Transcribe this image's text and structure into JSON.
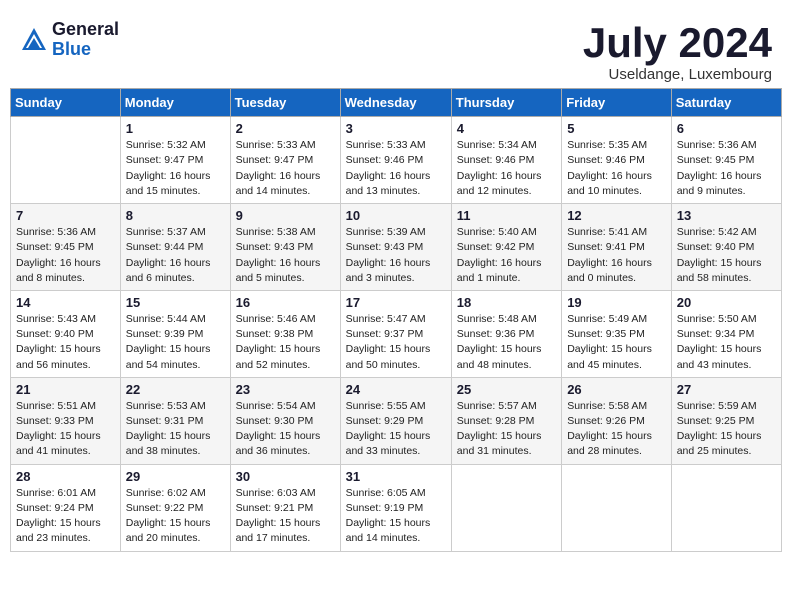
{
  "header": {
    "logo_general": "General",
    "logo_blue": "Blue",
    "month_title": "July 2024",
    "location": "Useldange, Luxembourg"
  },
  "days_of_week": [
    "Sunday",
    "Monday",
    "Tuesday",
    "Wednesday",
    "Thursday",
    "Friday",
    "Saturday"
  ],
  "weeks": [
    [
      {
        "day": "",
        "info": ""
      },
      {
        "day": "1",
        "info": "Sunrise: 5:32 AM\nSunset: 9:47 PM\nDaylight: 16 hours\nand 15 minutes."
      },
      {
        "day": "2",
        "info": "Sunrise: 5:33 AM\nSunset: 9:47 PM\nDaylight: 16 hours\nand 14 minutes."
      },
      {
        "day": "3",
        "info": "Sunrise: 5:33 AM\nSunset: 9:46 PM\nDaylight: 16 hours\nand 13 minutes."
      },
      {
        "day": "4",
        "info": "Sunrise: 5:34 AM\nSunset: 9:46 PM\nDaylight: 16 hours\nand 12 minutes."
      },
      {
        "day": "5",
        "info": "Sunrise: 5:35 AM\nSunset: 9:46 PM\nDaylight: 16 hours\nand 10 minutes."
      },
      {
        "day": "6",
        "info": "Sunrise: 5:36 AM\nSunset: 9:45 PM\nDaylight: 16 hours\nand 9 minutes."
      }
    ],
    [
      {
        "day": "7",
        "info": "Sunrise: 5:36 AM\nSunset: 9:45 PM\nDaylight: 16 hours\nand 8 minutes."
      },
      {
        "day": "8",
        "info": "Sunrise: 5:37 AM\nSunset: 9:44 PM\nDaylight: 16 hours\nand 6 minutes."
      },
      {
        "day": "9",
        "info": "Sunrise: 5:38 AM\nSunset: 9:43 PM\nDaylight: 16 hours\nand 5 minutes."
      },
      {
        "day": "10",
        "info": "Sunrise: 5:39 AM\nSunset: 9:43 PM\nDaylight: 16 hours\nand 3 minutes."
      },
      {
        "day": "11",
        "info": "Sunrise: 5:40 AM\nSunset: 9:42 PM\nDaylight: 16 hours\nand 1 minute."
      },
      {
        "day": "12",
        "info": "Sunrise: 5:41 AM\nSunset: 9:41 PM\nDaylight: 16 hours\nand 0 minutes."
      },
      {
        "day": "13",
        "info": "Sunrise: 5:42 AM\nSunset: 9:40 PM\nDaylight: 15 hours\nand 58 minutes."
      }
    ],
    [
      {
        "day": "14",
        "info": "Sunrise: 5:43 AM\nSunset: 9:40 PM\nDaylight: 15 hours\nand 56 minutes."
      },
      {
        "day": "15",
        "info": "Sunrise: 5:44 AM\nSunset: 9:39 PM\nDaylight: 15 hours\nand 54 minutes."
      },
      {
        "day": "16",
        "info": "Sunrise: 5:46 AM\nSunset: 9:38 PM\nDaylight: 15 hours\nand 52 minutes."
      },
      {
        "day": "17",
        "info": "Sunrise: 5:47 AM\nSunset: 9:37 PM\nDaylight: 15 hours\nand 50 minutes."
      },
      {
        "day": "18",
        "info": "Sunrise: 5:48 AM\nSunset: 9:36 PM\nDaylight: 15 hours\nand 48 minutes."
      },
      {
        "day": "19",
        "info": "Sunrise: 5:49 AM\nSunset: 9:35 PM\nDaylight: 15 hours\nand 45 minutes."
      },
      {
        "day": "20",
        "info": "Sunrise: 5:50 AM\nSunset: 9:34 PM\nDaylight: 15 hours\nand 43 minutes."
      }
    ],
    [
      {
        "day": "21",
        "info": "Sunrise: 5:51 AM\nSunset: 9:33 PM\nDaylight: 15 hours\nand 41 minutes."
      },
      {
        "day": "22",
        "info": "Sunrise: 5:53 AM\nSunset: 9:31 PM\nDaylight: 15 hours\nand 38 minutes."
      },
      {
        "day": "23",
        "info": "Sunrise: 5:54 AM\nSunset: 9:30 PM\nDaylight: 15 hours\nand 36 minutes."
      },
      {
        "day": "24",
        "info": "Sunrise: 5:55 AM\nSunset: 9:29 PM\nDaylight: 15 hours\nand 33 minutes."
      },
      {
        "day": "25",
        "info": "Sunrise: 5:57 AM\nSunset: 9:28 PM\nDaylight: 15 hours\nand 31 minutes."
      },
      {
        "day": "26",
        "info": "Sunrise: 5:58 AM\nSunset: 9:26 PM\nDaylight: 15 hours\nand 28 minutes."
      },
      {
        "day": "27",
        "info": "Sunrise: 5:59 AM\nSunset: 9:25 PM\nDaylight: 15 hours\nand 25 minutes."
      }
    ],
    [
      {
        "day": "28",
        "info": "Sunrise: 6:01 AM\nSunset: 9:24 PM\nDaylight: 15 hours\nand 23 minutes."
      },
      {
        "day": "29",
        "info": "Sunrise: 6:02 AM\nSunset: 9:22 PM\nDaylight: 15 hours\nand 20 minutes."
      },
      {
        "day": "30",
        "info": "Sunrise: 6:03 AM\nSunset: 9:21 PM\nDaylight: 15 hours\nand 17 minutes."
      },
      {
        "day": "31",
        "info": "Sunrise: 6:05 AM\nSunset: 9:19 PM\nDaylight: 15 hours\nand 14 minutes."
      },
      {
        "day": "",
        "info": ""
      },
      {
        "day": "",
        "info": ""
      },
      {
        "day": "",
        "info": ""
      }
    ]
  ]
}
